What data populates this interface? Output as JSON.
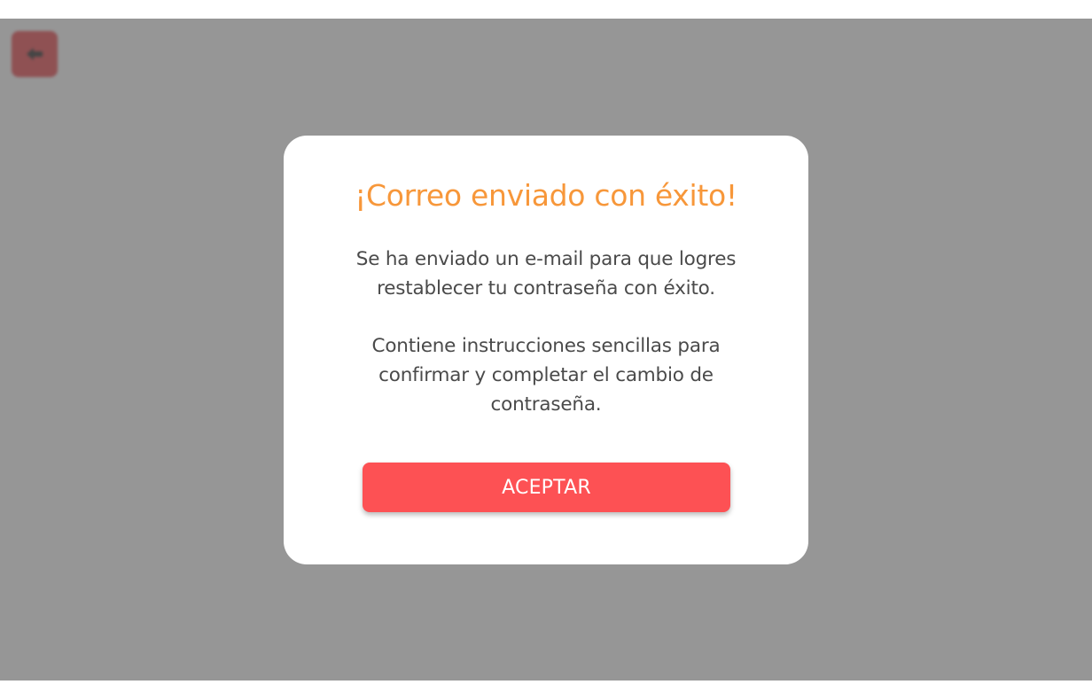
{
  "header": {
    "back_icon": "back-arrow-icon",
    "back_color": "#e0393f"
  },
  "modal": {
    "title": "¡Correo enviado con éxito!",
    "title_color": "#f7973a",
    "message_1": "Se ha enviado un e-mail para que logres restablecer tu contraseña con éxito.",
    "message_2": "Contiene instrucciones sencillas para confirmar y completar el cambio de contraseña.",
    "accept_label": "ACEPTAR",
    "accept_color": "#fd5154"
  }
}
